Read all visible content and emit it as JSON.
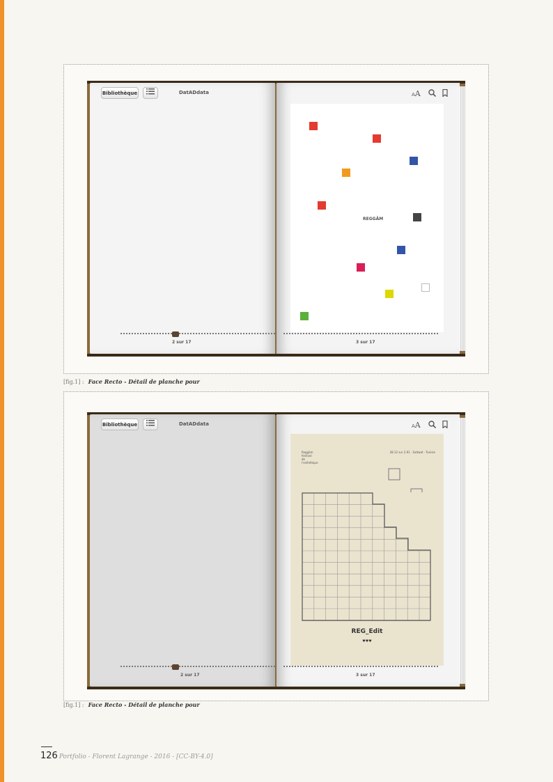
{
  "app": {
    "library_button": "Bibliothèque",
    "book_title": "DatADdata",
    "font_size_label": "AA",
    "search_icon": "search-icon",
    "bookmark_icon": "bookmark-icon",
    "toc_icon": "list-icon"
  },
  "spread1": {
    "left_page": "2 sur 17",
    "right_page": "3 sur 17",
    "cover_word": "REGGÄM",
    "squares_colors": [
      "#e53a2f",
      "#e53a2f",
      "#3255a8",
      "#f29a1f",
      "#e53a2f",
      "#444444",
      "#3255a8",
      "#d81f58",
      "#dcd800",
      "#ffffff",
      "#5ab038"
    ]
  },
  "spread2": {
    "left_page": "2 sur 17",
    "right_page": "3 sur 17",
    "header_left": "Reggäm\nfestival\nde\nl'esthétique",
    "header_right": "28.12 sur 2.91 · Saltwat · Tunisie",
    "cover_title": "REG_Edit",
    "cover_glyph": "♥♥♥"
  },
  "captions": [
    {
      "label": "[fig.1] :",
      "text": "Face Recto - Détail de planche pour"
    },
    {
      "label": "[fig.1] :",
      "text": "Face Recto - Détail de planche pour"
    }
  ],
  "footer": {
    "page_number": "126",
    "credit": "Portfolio - Florent Lagrange - 2016 - [CC-BY-4.0]"
  }
}
